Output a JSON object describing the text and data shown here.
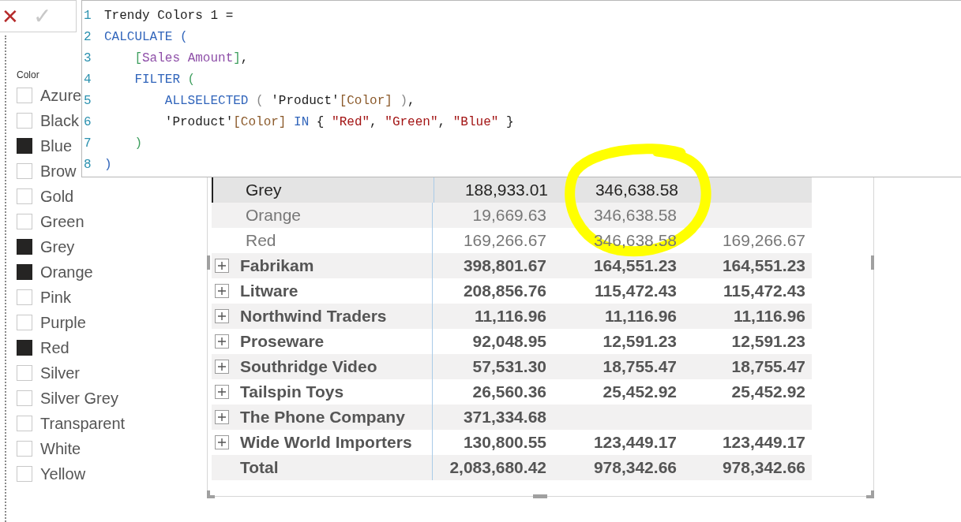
{
  "toolbar": {
    "cancel": "✕",
    "commit": "✓"
  },
  "editor": {
    "lines": [
      {
        "number": "1",
        "tokens": [
          {
            "kind": "text",
            "text": "Trendy Colors 1 ="
          }
        ]
      },
      {
        "number": "2",
        "tokens": [
          {
            "kind": "keyword",
            "text": "CALCULATE"
          },
          {
            "kind": "paren1",
            "text": " ("
          }
        ]
      },
      {
        "number": "3",
        "tokens": [
          {
            "kind": "paren2",
            "text": "    ["
          },
          {
            "kind": "measure",
            "text": "Sales Amount"
          },
          {
            "kind": "paren2",
            "text": "]"
          },
          {
            "kind": "text",
            "text": ","
          }
        ]
      },
      {
        "number": "4",
        "tokens": [
          {
            "kind": "keyword",
            "text": "    FILTER"
          },
          {
            "kind": "paren2",
            "text": " ("
          }
        ]
      },
      {
        "number": "5",
        "tokens": [
          {
            "kind": "keyword",
            "text": "        ALLSELECTED"
          },
          {
            "kind": "paren3",
            "text": " ("
          },
          {
            "kind": "text",
            "text": " 'Product'"
          },
          {
            "kind": "column",
            "text": "[Color]"
          },
          {
            "kind": "paren3",
            "text": " )"
          },
          {
            "kind": "text",
            "text": ","
          }
        ]
      },
      {
        "number": "6",
        "tokens": [
          {
            "kind": "text",
            "text": "        'Product'"
          },
          {
            "kind": "column",
            "text": "[Color]"
          },
          {
            "kind": "keyword",
            "text": " IN"
          },
          {
            "kind": "text",
            "text": " { "
          },
          {
            "kind": "string",
            "text": "\"Red\""
          },
          {
            "kind": "text",
            "text": ", "
          },
          {
            "kind": "string",
            "text": "\"Green\""
          },
          {
            "kind": "text",
            "text": ", "
          },
          {
            "kind": "string",
            "text": "\"Blue\""
          },
          {
            "kind": "text",
            "text": " }"
          }
        ]
      },
      {
        "number": "7",
        "tokens": [
          {
            "kind": "paren2",
            "text": "    )"
          }
        ]
      },
      {
        "number": "8",
        "tokens": [
          {
            "kind": "paren1",
            "text": ")"
          }
        ]
      }
    ]
  },
  "slicer": {
    "title": "Color",
    "items": [
      {
        "label": "Azure",
        "checked": false
      },
      {
        "label": "Black",
        "checked": false
      },
      {
        "label": "Blue",
        "checked": true
      },
      {
        "label": "Brow",
        "checked": false
      },
      {
        "label": "Gold",
        "checked": false
      },
      {
        "label": "Green",
        "checked": false
      },
      {
        "label": "Grey",
        "checked": true
      },
      {
        "label": "Orange",
        "checked": true
      },
      {
        "label": "Pink",
        "checked": false
      },
      {
        "label": "Purple",
        "checked": false
      },
      {
        "label": "Red",
        "checked": true
      },
      {
        "label": "Silver",
        "checked": false
      },
      {
        "label": "Silver Grey",
        "checked": false
      },
      {
        "label": "Transparent",
        "checked": false
      },
      {
        "label": "White",
        "checked": false
      },
      {
        "label": "Yellow",
        "checked": false
      }
    ]
  },
  "table": {
    "rows": [
      {
        "kind": "child",
        "name": "Grey",
        "selected": true,
        "values": {
          "column_1": "188,933.01",
          "column_2": "346,638.58"
        }
      },
      {
        "kind": "child",
        "name": "Orange",
        "selected": false,
        "values": {
          "column_1": "19,669.63",
          "column_2": "346,638.58"
        }
      },
      {
        "kind": "child",
        "name": "Red",
        "selected": false,
        "values": {
          "column_1": "169,266.67",
          "column_2": "346,638.58",
          "column_3": "169,266.67"
        }
      },
      {
        "kind": "group",
        "name": "Fabrikam",
        "values": {
          "column_1": "398,801.67",
          "column_2": "164,551.23",
          "column_3": "164,551.23"
        }
      },
      {
        "kind": "group",
        "name": "Litware",
        "values": {
          "column_1": "208,856.76",
          "column_2": "115,472.43",
          "column_3": "115,472.43"
        }
      },
      {
        "kind": "group",
        "name": "Northwind Traders",
        "values": {
          "column_1": "11,116.96",
          "column_2": "11,116.96",
          "column_3": "11,116.96"
        }
      },
      {
        "kind": "group",
        "name": "Proseware",
        "values": {
          "column_1": "92,048.95",
          "column_2": "12,591.23",
          "column_3": "12,591.23"
        }
      },
      {
        "kind": "group",
        "name": "Southridge Video",
        "values": {
          "column_1": "57,531.30",
          "column_2": "18,755.47",
          "column_3": "18,755.47"
        }
      },
      {
        "kind": "group",
        "name": "Tailspin Toys",
        "values": {
          "column_1": "26,560.36",
          "column_2": "25,452.92",
          "column_3": "25,452.92"
        }
      },
      {
        "kind": "group",
        "name": "The Phone Company",
        "values": {
          "column_1": "371,334.68"
        }
      },
      {
        "kind": "group",
        "name": "Wide World Importers",
        "values": {
          "column_1": "130,800.55",
          "column_2": "123,449.17",
          "column_3": "123,449.17"
        }
      },
      {
        "kind": "total",
        "name": "Total",
        "values": {
          "column_1": "2,083,680.42",
          "column_2": "978,342.66",
          "column_3": "978,342.66"
        }
      }
    ]
  }
}
